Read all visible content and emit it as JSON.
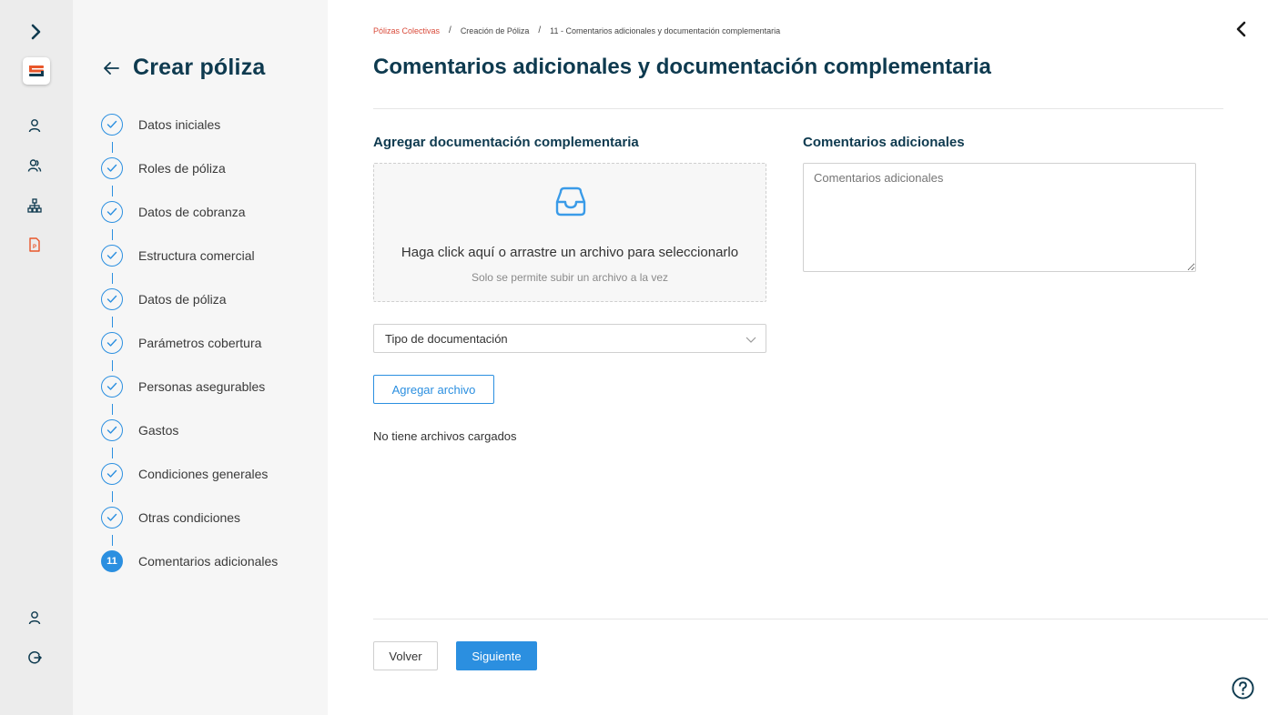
{
  "sidebar": {
    "logo_letter": "S",
    "icons": [
      "chevron-right-icon",
      "user-icon",
      "users-icon",
      "org-chart-icon",
      "document-policy-icon"
    ],
    "bottom_icons": [
      "profile-icon",
      "logout-icon"
    ]
  },
  "stepper": {
    "title": "Crear póliza",
    "active_number": "11",
    "steps": [
      {
        "label": "Datos iniciales",
        "status": "done"
      },
      {
        "label": "Roles de póliza",
        "status": "done"
      },
      {
        "label": "Datos de cobranza",
        "status": "done"
      },
      {
        "label": "Estructura comercial",
        "status": "done"
      },
      {
        "label": "Datos de póliza",
        "status": "done"
      },
      {
        "label": "Parámetros cobertura",
        "status": "done"
      },
      {
        "label": "Personas asegurables",
        "status": "done"
      },
      {
        "label": "Gastos",
        "status": "done"
      },
      {
        "label": "Condiciones generales",
        "status": "done"
      },
      {
        "label": "Otras condiciones",
        "status": "done"
      },
      {
        "label": "Comentarios adicionales",
        "status": "active"
      }
    ]
  },
  "breadcrumb": {
    "items": [
      "Pólizas Colectivas",
      "Creación de Póliza",
      "11 - Comentarios adicionales y documentación complementaria"
    ],
    "separator": "/"
  },
  "page": {
    "title": "Comentarios adicionales y documentación complementaria"
  },
  "upload": {
    "section_title": "Agregar documentación complementaria",
    "dropzone_text": "Haga click aquí o arrastre un archivo para seleccionarlo",
    "dropzone_hint": "Solo se permite subir un archivo a la vez",
    "doc_type_placeholder": "Tipo de documentación",
    "add_button": "Agregar archivo",
    "empty_message": "No tiene archivos cargados"
  },
  "comments": {
    "section_title": "Comentarios adicionales",
    "placeholder": "Comentarios adicionales",
    "value": ""
  },
  "footer": {
    "back_label": "Volver",
    "next_label": "Siguiente"
  },
  "colors": {
    "primary": "#2b8fe0",
    "title": "#0e3a4f",
    "breadcrumb_link": "#d94a3a",
    "brand_orange": "#e8562a"
  }
}
